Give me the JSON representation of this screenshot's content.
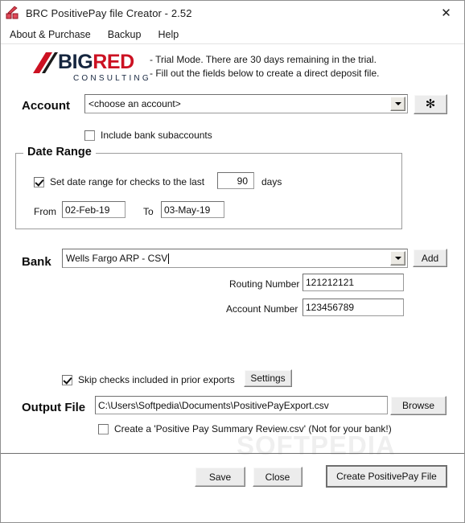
{
  "window": {
    "title": "BRC PositivePay file Creator - 2.52",
    "app_icon": "brc-app-icon",
    "close_label": "✕"
  },
  "menubar": {
    "items": [
      {
        "label": "About & Purchase"
      },
      {
        "label": "Backup"
      },
      {
        "label": "Help"
      }
    ]
  },
  "branding": {
    "logo_big": "BIG",
    "logo_red": "RED",
    "logo_sub": "CONSULTING",
    "trial_line1": "- Trial Mode. There are 30 days remaining in the trial.",
    "trial_line2": "- Fill out the fields below to create a direct deposit file.",
    "brand_red": "#cc1122",
    "brand_navy": "#16263f"
  },
  "account": {
    "label": "Account",
    "selected": "<choose an account>",
    "refresh_glyph": "✻",
    "subaccounts_label": "Include bank subaccounts",
    "subaccounts_checked": false
  },
  "date_range": {
    "title": "Date Range",
    "set_range_label": "Set date range for checks to the last",
    "set_range_checked": true,
    "days_value": "90",
    "days_suffix": "days",
    "from_label": "From",
    "from_value": "02-Feb-19",
    "to_label": "To",
    "to_value": "03-May-19"
  },
  "bank": {
    "label": "Bank",
    "selected": "Wells Fargo ARP - CSV",
    "add_label": "Add",
    "routing_label": "Routing Number",
    "routing_value": "121212121",
    "account_number_label": "Account Number",
    "account_number_value": "123456789"
  },
  "output": {
    "skip_label": "Skip checks included in prior exports",
    "skip_checked": true,
    "settings_label": "Settings",
    "output_label": "Output File",
    "output_value": "C:\\Users\\Softpedia\\Documents\\PositivePayExport.csv",
    "browse_label": "Browse",
    "summary_label": "Create a 'Positive Pay Summary Review.csv' (Not for your bank!)",
    "summary_checked": false
  },
  "footer": {
    "save_label": "Save",
    "close_label": "Close",
    "create_label": "Create PositivePay File"
  },
  "watermark": {
    "text": "SOFTPEDIA"
  }
}
